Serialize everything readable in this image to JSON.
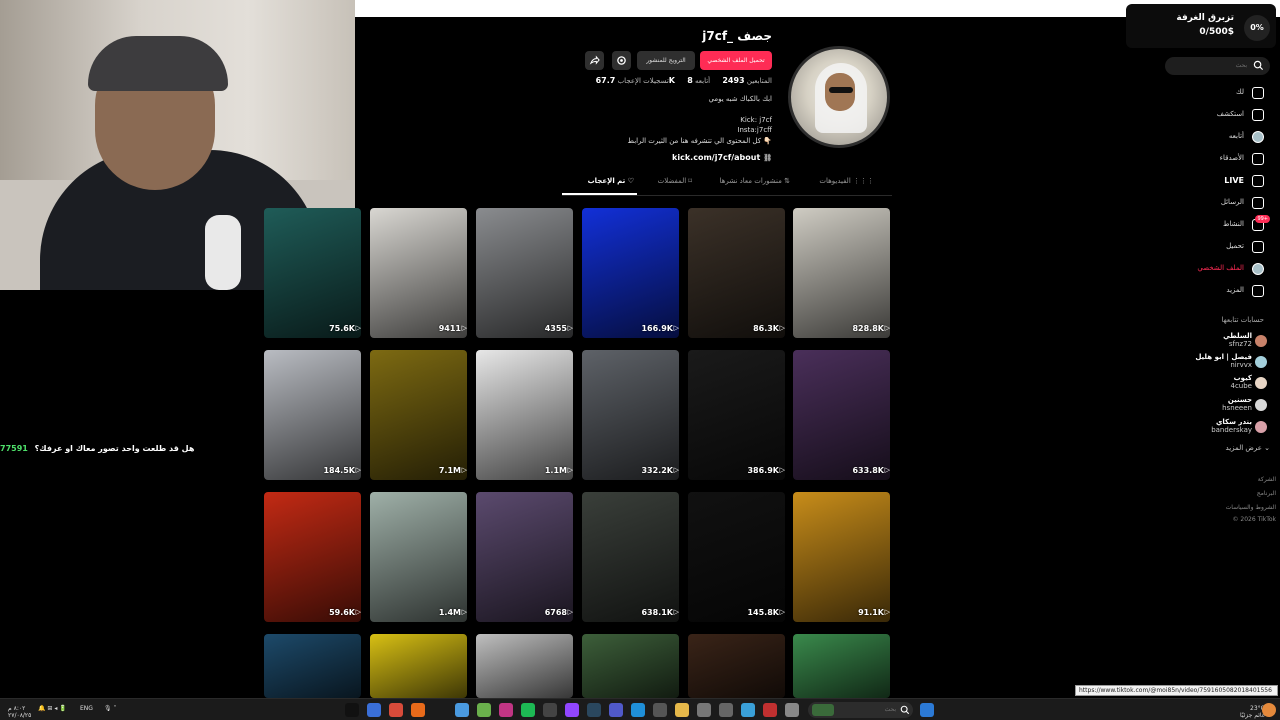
{
  "gift_widget": {
    "title": "تزبرق الغرفة",
    "amount": "0/500$",
    "percent": "0%"
  },
  "chat": {
    "user_id": "77591",
    "message": "هل قد طلعت واحد تصور معاك او عرفك؟"
  },
  "profile": {
    "username": "j7cf_ جصف",
    "follow_button": "تحميل الملف الشخصي",
    "promote_button": "الترويج للمنشور",
    "stats": {
      "following_label": "أتابعه",
      "following_value": "8",
      "followers_label": "المتابعين",
      "followers_value": "2493",
      "likes_label": "تسجيلات الإعجاب",
      "likes_value": "67.7K"
    },
    "bio": [
      "ابك بالكباك شبه يومي",
      "Kick: j7cf",
      "Insta:j7cff",
      "كل المحتوى الي تتشرفه هنا من الثيرت الرابط 👇🏻"
    ],
    "link": "kick.com/j7cf/about"
  },
  "tabs": [
    {
      "label": "الفيديوهات",
      "icon": "grid-icon"
    },
    {
      "label": "منشورات معاد نشرها",
      "icon": "repost-icon"
    },
    {
      "label": "المفضلات",
      "icon": "bookmark-icon"
    },
    {
      "label": "تم الإعجاب",
      "icon": "heart-outline-icon"
    }
  ],
  "videos": [
    {
      "views": "75.6K",
      "color": "#1f5c58"
    },
    {
      "views": "9411",
      "color": "#d9d7d2"
    },
    {
      "views": "4355",
      "color": "#8a8c8f"
    },
    {
      "views": "166.9K",
      "color": "#1230d8"
    },
    {
      "views": "86.3K",
      "color": "#3b3128"
    },
    {
      "views": "828.8K",
      "color": "#cfccc3"
    },
    {
      "views": "184.5K",
      "color": "#b9bcc2"
    },
    {
      "views": "7.1M",
      "color": "#7d6a12"
    },
    {
      "views": "1.1M",
      "color": "#e7e7e7"
    },
    {
      "views": "332.2K",
      "color": "#5e6268"
    },
    {
      "views": "386.9K",
      "color": "#1a1a1a"
    },
    {
      "views": "633.8K",
      "color": "#4a2f5a"
    },
    {
      "views": "59.6K",
      "color": "#c32a14"
    },
    {
      "views": "1.4M",
      "color": "#9fb0a8"
    },
    {
      "views": "6768",
      "color": "#5b4a6e"
    },
    {
      "views": "638.1K",
      "color": "#3a3f3a"
    },
    {
      "views": "145.8K",
      "color": "#111111"
    },
    {
      "views": "91.1K",
      "color": "#c88d1a"
    },
    {
      "views": "",
      "color": "#1d4a6a"
    },
    {
      "views": "",
      "color": "#d8c014"
    },
    {
      "views": "",
      "color": "#bfbfbf"
    },
    {
      "views": "",
      "color": "#3d5f3a"
    },
    {
      "views": "",
      "color": "#3a2418"
    },
    {
      "views": "",
      "color": "#3a8a4c"
    }
  ],
  "nav": {
    "search_placeholder": "بحث",
    "items": [
      {
        "label": "لك",
        "icon": "home-icon"
      },
      {
        "label": "استكشف",
        "icon": "compass-icon"
      },
      {
        "label": "أتابعه",
        "icon": "avatar-icon"
      },
      {
        "label": "الأصدقاء",
        "icon": "friends-icon"
      },
      {
        "label": "LIVE",
        "icon": "live-icon"
      },
      {
        "label": "الرسائل",
        "icon": "send-icon"
      },
      {
        "label": "النشاط",
        "icon": "inbox-icon",
        "badge": "99+"
      },
      {
        "label": "تحميل",
        "icon": "upload-icon"
      },
      {
        "label": "الملف الشخصي",
        "icon": "profile-icon"
      },
      {
        "label": "المزيد",
        "icon": "more-icon"
      }
    ],
    "following_title": "حسابات تتابعها",
    "following": [
      {
        "name": "السلطي",
        "handle": "sfnz72",
        "color": "#c8826a"
      },
      {
        "name": "فيصل | ابو هليل",
        "handle": "nirvvx",
        "color": "#a4d0dc"
      },
      {
        "name": "كيوب",
        "handle": "4cube",
        "color": "#e8d6c6"
      },
      {
        "name": "حسنين",
        "handle": "hsneeen",
        "color": "#d8d8d8"
      },
      {
        "name": "بندر سكاي",
        "handle": "banderskay",
        "color": "#d8a0a8"
      }
    ],
    "show_more": "عرض المزيد",
    "footer": [
      "الشركة",
      "البرنامج",
      "الشروط والسياسات",
      "© 2026 TikTok"
    ]
  },
  "url_tooltip": "https://www.tiktok.com/@moi85n/video/7591605082018401556",
  "taskbar": {
    "search_placeholder": "بحث",
    "weather_temp": "23°C",
    "weather_desc": "غائم جزئيًا",
    "lang": "ENG",
    "time": "٨:٠٢ م",
    "date": "٢٧/٠٨/٢٥"
  }
}
